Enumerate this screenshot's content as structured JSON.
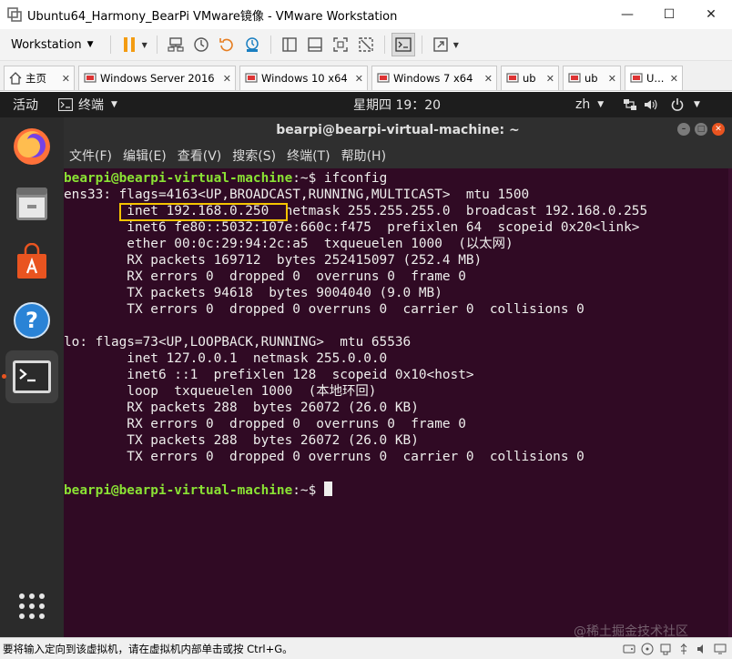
{
  "window": {
    "title": "Ubuntu64_Harmony_BearPi VMware镜像 - VMware Workstation",
    "minimize": "—",
    "maximize": "☐",
    "close": "✕"
  },
  "toolbar": {
    "workstation_menu": "Workstation"
  },
  "tabs": [
    {
      "label": "主页",
      "icon": "home-icon"
    },
    {
      "label": "Windows Server 2016",
      "icon": "vm-icon"
    },
    {
      "label": "Windows 10 x64",
      "icon": "vm-icon"
    },
    {
      "label": "Windows 7 x64",
      "icon": "vm-icon"
    },
    {
      "label": "ub",
      "icon": "vm-icon"
    },
    {
      "label": "ub",
      "icon": "vm-icon"
    },
    {
      "label": "U...",
      "icon": "vm-icon"
    }
  ],
  "ubuntu": {
    "activities": "活动",
    "app_name": "终端",
    "clock": "星期四 19：20",
    "input_method": "zh"
  },
  "terminal": {
    "title": "bearpi@bearpi-virtual-machine: ~",
    "menu": [
      "文件(F)",
      "编辑(E)",
      "查看(V)",
      "搜索(S)",
      "终端(T)",
      "帮助(H)"
    ],
    "prompt_user": "bearpi@bearpi-virtual-machine",
    "prompt_suffix": ":~$ ",
    "command": "ifconfig",
    "lines": [
      "ens33: flags=4163<UP,BROADCAST,RUNNING,MULTICAST>  mtu 1500",
      "        inet 192.168.0.250  netmask 255.255.255.0  broadcast 192.168.0.255",
      "        inet6 fe80::5032:107e:660c:f475  prefixlen 64  scopeid 0x20<link>",
      "        ether 00:0c:29:94:2c:a5  txqueuelen 1000  (以太网)",
      "        RX packets 169712  bytes 252415097 (252.4 MB)",
      "        RX errors 0  dropped 0  overruns 0  frame 0",
      "        TX packets 94618  bytes 9004040 (9.0 MB)",
      "        TX errors 0  dropped 0 overruns 0  carrier 0  collisions 0",
      "",
      "lo: flags=73<UP,LOOPBACK,RUNNING>  mtu 65536",
      "        inet 127.0.0.1  netmask 255.0.0.0",
      "        inet6 ::1  prefixlen 128  scopeid 0x10<host>",
      "        loop  txqueuelen 1000  (本地环回)",
      "        RX packets 288  bytes 26072 (26.0 KB)",
      "        RX errors 0  dropped 0  overruns 0  frame 0",
      "        TX packets 288  bytes 26072 (26.0 KB)",
      "        TX errors 0  dropped 0 overruns 0  carrier 0  collisions 0"
    ],
    "highlight_color": "#f5c400"
  },
  "statusbar": {
    "message": "要将输入定向到该虚拟机，请在虚拟机内部单击或按 Ctrl+G。"
  },
  "watermark": "@稀土掘金技术社区",
  "colors": {
    "terminal_bg": "#300a24",
    "prompt_green": "#8ae234",
    "ubuntu_orange": "#e95420",
    "vmware_pause": "#f39c12"
  }
}
